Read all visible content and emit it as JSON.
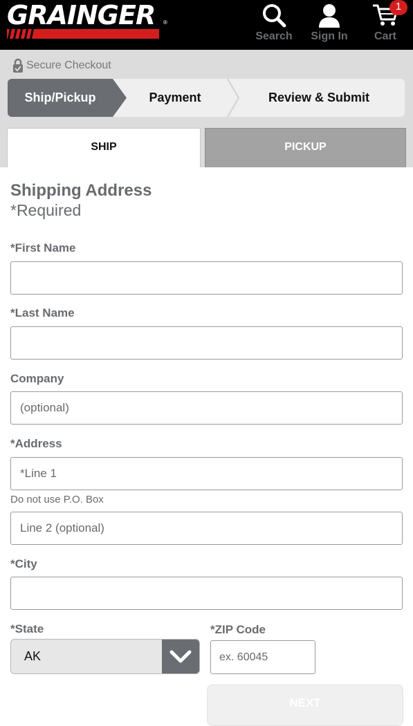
{
  "header": {
    "logo_text": "GRAINGER",
    "logo_reg": "®",
    "search_label": "Search",
    "signin_label": "Sign In",
    "cart_label": "Cart",
    "cart_count": "1",
    "icons": {
      "search": "search-icon",
      "signin": "user-icon",
      "cart": "cart-icon"
    }
  },
  "checkout": {
    "secure_label": "Secure Checkout",
    "steps": [
      {
        "label": "Ship/Pickup",
        "active": true
      },
      {
        "label": "Payment",
        "active": false
      },
      {
        "label": "Review & Submit",
        "active": false
      }
    ]
  },
  "tabs": [
    {
      "label": "SHIP",
      "selected": true
    },
    {
      "label": "PICKUP",
      "selected": false
    }
  ],
  "form": {
    "title": "Shipping Address",
    "required_note": "*Required",
    "first_name": {
      "label": "*First Name",
      "placeholder": ""
    },
    "last_name": {
      "label": "*Last Name",
      "placeholder": ""
    },
    "company": {
      "label": "Company",
      "placeholder": "(optional)"
    },
    "address": {
      "label": "*Address",
      "line1_placeholder": "*Line 1",
      "hint": "Do not use P.O. Box",
      "line2_placeholder": "Line 2 (optional)"
    },
    "city": {
      "label": "*City",
      "placeholder": ""
    },
    "state": {
      "label": "*State",
      "value": "AK"
    },
    "zip": {
      "label": "*ZIP Code",
      "placeholder": "ex. 60045"
    },
    "next_label": "NEXT"
  },
  "colors": {
    "brand_red": "#d41e1e",
    "header_bg": "#000000",
    "active_step": "#6a6d72",
    "label_grey": "#686b6f"
  }
}
